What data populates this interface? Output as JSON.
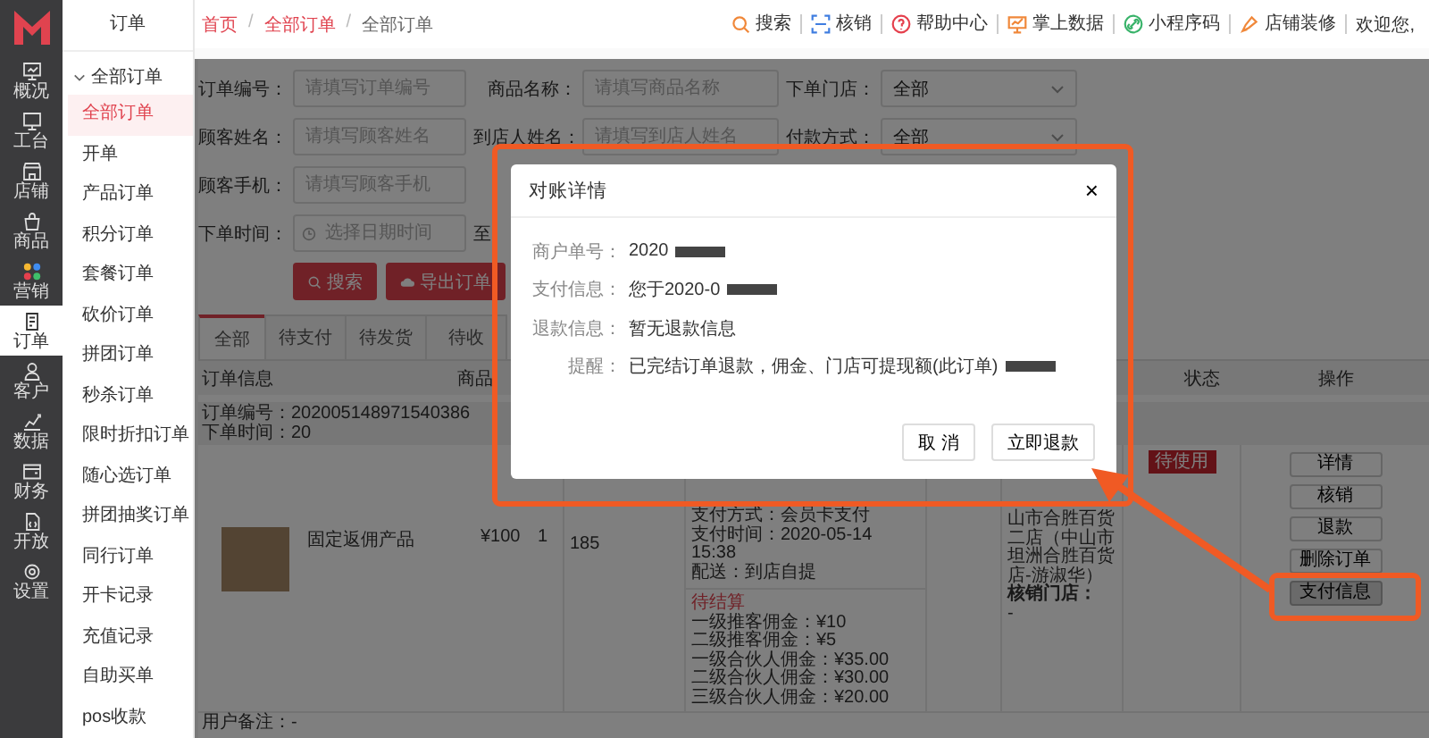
{
  "sidebar": {
    "rail": [
      {
        "label": "概况",
        "selected": false
      },
      {
        "label": "工台",
        "selected": false
      },
      {
        "label": "店铺",
        "selected": false
      },
      {
        "label": "商品",
        "selected": false
      },
      {
        "label": "营销",
        "selected": false
      },
      {
        "label": "订单",
        "selected": true
      },
      {
        "label": "客户",
        "selected": false
      },
      {
        "label": "数据",
        "selected": false
      },
      {
        "label": "财务",
        "selected": false
      },
      {
        "label": "开放",
        "selected": false
      },
      {
        "label": "设置",
        "selected": false
      }
    ],
    "menu": {
      "title": "订单",
      "group": {
        "label": "全部订单",
        "expanded": true,
        "children": [
          {
            "label": "全部订单",
            "selected": true
          },
          {
            "label": "开单",
            "selected": false
          },
          {
            "label": "产品订单",
            "selected": false
          },
          {
            "label": "积分订单",
            "selected": false
          },
          {
            "label": "套餐订单",
            "selected": false
          },
          {
            "label": "砍价订单",
            "selected": false
          },
          {
            "label": "拼团订单",
            "selected": false
          },
          {
            "label": "秒杀订单",
            "selected": false
          },
          {
            "label": "限时折扣订单",
            "selected": false
          },
          {
            "label": "随心选订单",
            "selected": false
          },
          {
            "label": "拼团抽奖订单",
            "selected": false
          },
          {
            "label": "同行订单",
            "selected": false
          },
          {
            "label": "开卡记录",
            "selected": false
          },
          {
            "label": "充值记录",
            "selected": false
          },
          {
            "label": "自助买单",
            "selected": false
          },
          {
            "label": "pos收款",
            "selected": false
          }
        ]
      }
    }
  },
  "breadcrumb": {
    "separator": "/",
    "items": [
      {
        "label": "首页",
        "link": true
      },
      {
        "label": "全部订单",
        "link": true
      },
      {
        "label": "全部订单",
        "link": false
      }
    ]
  },
  "top_links": [
    "搜索",
    "核销",
    "帮助中心",
    "掌上数据",
    "小程序码",
    "店铺装修"
  ],
  "welcome": "欢迎您,",
  "filters": [
    [
      {
        "kind": "text",
        "label": "订单编号：",
        "placeholder": "请填写订单编号"
      },
      {
        "kind": "text",
        "label": "商品名称：",
        "placeholder": "请填写商品名称"
      },
      {
        "kind": "select",
        "label": "下单门店：",
        "value": "全部"
      }
    ],
    [
      {
        "kind": "text",
        "label": "顾客姓名：",
        "placeholder": "请填写顾客姓名"
      },
      {
        "kind": "text",
        "label": "到店人姓名：",
        "placeholder": "请填写到店人姓名"
      },
      {
        "kind": "select",
        "label": "付款方式：",
        "value": "全部"
      }
    ],
    [
      {
        "kind": "text",
        "label": "顾客手机：",
        "placeholder": "请填写顾客手机"
      }
    ],
    [
      {
        "kind": "date",
        "label": "下单时间：",
        "placeholder": "选择日期时间"
      },
      {
        "kind": "range",
        "label": "至"
      }
    ]
  ],
  "filter_buttons": [
    {
      "kind": "search",
      "label": "搜索"
    },
    {
      "kind": "export",
      "label": "导出订单"
    }
  ],
  "tabs": [
    {
      "label": "全部",
      "selected": true
    },
    {
      "label": "待支付",
      "selected": false
    },
    {
      "label": "待发货",
      "selected": false
    },
    {
      "label": "待收",
      "selected": false
    }
  ],
  "table": {
    "columns": [
      "订单信息",
      "商品",
      "状态",
      "操作"
    ],
    "order": {
      "number": "订单编号：202005148971540386",
      "time": "下单时间：20",
      "product": {
        "name": "固定返佣产品",
        "price": "¥100",
        "qty": "1"
      },
      "buyer": "185",
      "payment": [
        "支付方式：会员卡支付",
        "支付时间：2020-05-14 15:38",
        "配送：到店自提"
      ],
      "commission": {
        "status": "待结算",
        "lines": [
          "一级推客佣金：¥10",
          "二级推客佣金：¥5",
          "一级合伙人佣金：¥35.00",
          "二级合伙人佣金：¥30.00",
          "三级合伙人佣金：¥20.00"
        ]
      },
      "store": "山市合胜百货二店（中山市坦洲合胜百货店-游淑华）",
      "verify_store_label": "核销门店：",
      "verify_store": "-",
      "status": "待使用",
      "actions": [
        {
          "label": "详情",
          "pressed": false
        },
        {
          "label": "核销",
          "pressed": false
        },
        {
          "label": "退款",
          "pressed": false
        },
        {
          "label": "删除订单",
          "pressed": false
        },
        {
          "label": "支付信息",
          "pressed": true
        }
      ],
      "remark": "用户备注：-"
    }
  },
  "modal": {
    "title": "对账详情",
    "close": "×",
    "rows": [
      {
        "label": "商户单号：",
        "value": "2020",
        "redacted": true
      },
      {
        "label": "支付信息：",
        "value": "您于2020-0",
        "redacted": true
      },
      {
        "label": "退款信息：",
        "value": "暂无退款信息",
        "redacted": false
      },
      {
        "label": "提醒：",
        "value": "已完结订单退款，佣金、门店可提现额(此订单)",
        "redacted": true
      }
    ],
    "buttons": [
      "取 消",
      "立即退款"
    ]
  }
}
